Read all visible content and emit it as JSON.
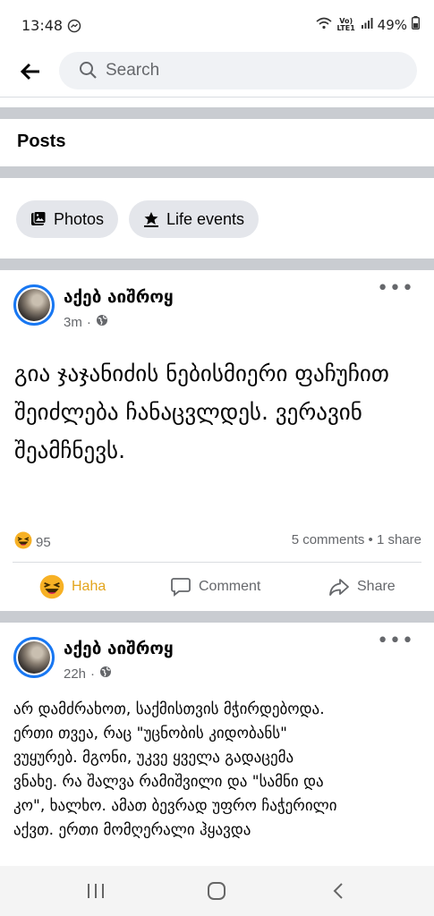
{
  "status": {
    "time": "13:48",
    "volte": "Vo) LTE1",
    "battery": "49%"
  },
  "search": {
    "placeholder": "Search"
  },
  "section": {
    "title": "Posts"
  },
  "chips": [
    {
      "label": "Photos",
      "icon": "photos-icon"
    },
    {
      "label": "Life events",
      "icon": "star-flag-icon"
    }
  ],
  "posts": [
    {
      "author": "აქებ აიშროყ",
      "time": "3m",
      "text": "გია ჯაჯანიძის ნებისმიერი ფაჩუჩით შეიძლება ჩანაცვლდეს. ვერავინ შეამჩნევს.",
      "reaction_count": "95",
      "counts": "5 comments • 1 share",
      "actions": {
        "haha": "Haha",
        "comment": "Comment",
        "share": "Share"
      },
      "haha_color": "#f7b125"
    },
    {
      "author": "აქებ აიშროყ",
      "time": "22h",
      "lines": [
        "არ დამძრახოთ, საქმისთვის მჭირდებოდა.",
        "ერთი თვეა, რაც \"უცნობის კიდობანს\"",
        "ვუყურებ. მგონი, უკვე ყველა გადაცემა",
        "ვნახე. რა შალვა რამიშვილი და \"სამნი და",
        "კო\", ხალხო. ამათ ბევრად უფრო ჩაჭერილი",
        "აქვთ. ერთი მომღერალი ჰყავდა"
      ]
    }
  ],
  "colors": {
    "accent": "#1877f2",
    "divider": "#c9ccd1",
    "muted": "#65676b"
  }
}
